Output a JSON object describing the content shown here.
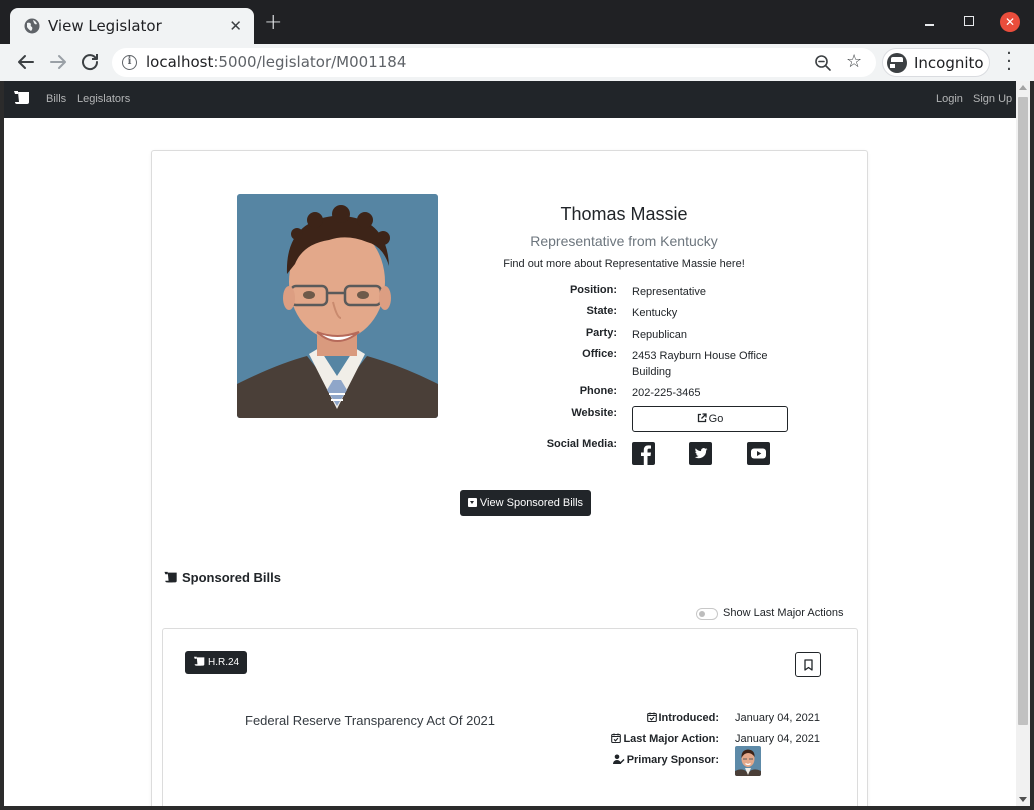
{
  "browser": {
    "tab_title": "View Legislator",
    "tab_close": "✕",
    "new_tab": "+",
    "url_host": "localhost",
    "url_rest": ":5000/legislator/M001184",
    "incognito_label": "Incognito",
    "window_close": "✕"
  },
  "site_nav": {
    "links": [
      "Bills",
      "Legislators"
    ],
    "right_links": [
      "Login",
      "Sign Up"
    ]
  },
  "legislator": {
    "name": "Thomas Massie",
    "subtitle": "Representative from Kentucky",
    "find_out": "Find out more about Representative Massie here!",
    "fields": [
      {
        "label": "Position:",
        "value": "Representative"
      },
      {
        "label": "State:",
        "value": "Kentucky"
      },
      {
        "label": "Party:",
        "value": "Republican"
      },
      {
        "label": "Office:",
        "value": "2453 Rayburn House Office Building"
      },
      {
        "label": "Phone:",
        "value": "202-225-3465"
      }
    ],
    "website_label": "Website:",
    "website_button": "Go",
    "social_label": "Social Media:",
    "social_icons": [
      "facebook-icon",
      "twitter-icon",
      "youtube-icon"
    ],
    "view_bills_button": "View Sponsored Bills"
  },
  "sponsored": {
    "heading": "Sponsored Bills",
    "toggle_label": "Show Last Major Actions",
    "bills": [
      {
        "number": "H.R.24",
        "title": "Federal Reserve Transparency Act Of 2021",
        "introduced_label": "Introduced:",
        "introduced": "January 04, 2021",
        "last_action_label": "Last Major Action:",
        "last_action": "January 04, 2021",
        "sponsor_label": "Primary Sponsor:"
      }
    ]
  },
  "colors": {
    "navbar": "#212529",
    "browser_frame": "#202124",
    "accent_close": "#ea4d3c",
    "muted": "#6c757d"
  }
}
